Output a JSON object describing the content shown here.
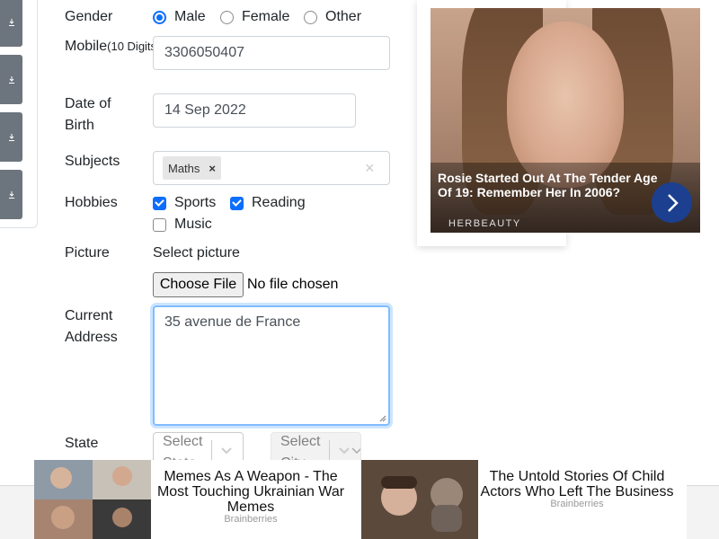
{
  "form": {
    "gender": {
      "label": "Gender",
      "options": [
        "Male",
        "Female",
        "Other"
      ],
      "selected": "Male"
    },
    "mobile": {
      "label": "Mobile",
      "hint": "(10 Digits)",
      "value": "3306050407"
    },
    "dob": {
      "label_line1": "Date of",
      "label_line2": "Birth",
      "value": "14 Sep 2022"
    },
    "subjects": {
      "label": "Subjects",
      "chips": [
        "Maths"
      ],
      "chip_remove": "×",
      "clear": "×"
    },
    "hobbies": {
      "label": "Hobbies",
      "options": [
        {
          "name": "Sports",
          "checked": true
        },
        {
          "name": "Reading",
          "checked": true
        },
        {
          "name": "Music",
          "checked": false
        }
      ]
    },
    "picture": {
      "label": "Picture",
      "caption": "Select picture",
      "button": "Choose File",
      "status": "No file chosen"
    },
    "address": {
      "label_line1": "Current",
      "label_line2": "Address",
      "value": "35 avenue de France"
    },
    "state": {
      "label": "State",
      "state_placeholder": "Select State",
      "city_placeholder": "Select City"
    }
  },
  "ad_right": {
    "title": "Rosie Started Out At The Tender Age Of 19: Remember Her In 2006?",
    "brand": "HERBEAUTY"
  },
  "bottom_ads": [
    {
      "title": "Memes As A Weapon - The Most Touching Ukrainian War Memes",
      "source": "Brainberries"
    },
    {
      "title": "The Untold Stories Of Child Actors Who Left The Business",
      "source": "Brainberries"
    }
  ],
  "colors": {
    "accent": "#0d6efd",
    "sidebar_button": "#6c757d",
    "ad_next": "#1c3f8f"
  },
  "icons": {
    "sidebar": "download-icon",
    "ad_next": "chevron-right-icon",
    "select": "chevron-down-icon"
  }
}
